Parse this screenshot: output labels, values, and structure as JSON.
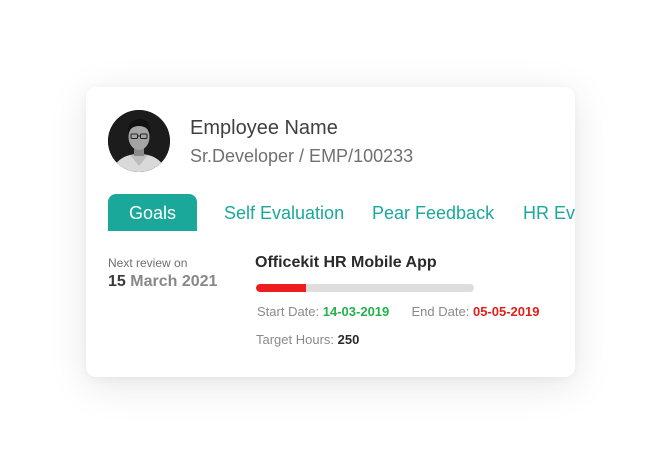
{
  "employee": {
    "name": "Employee Name",
    "subtitle": "Sr.Developer / EMP/100233"
  },
  "tabs": [
    {
      "label": "Goals",
      "active": true
    },
    {
      "label": "Self Evaluation",
      "active": false
    },
    {
      "label": "Pear Feedback",
      "active": false
    },
    {
      "label": "HR Evaluation",
      "active": false
    }
  ],
  "review": {
    "label": "Next review on",
    "day": "15",
    "month_year": "March 2021"
  },
  "project": {
    "title": "Officekit HR Mobile App",
    "progress_fraction": 0.23,
    "start_label": "Start Date:",
    "start_value": "14-03-2019",
    "end_label": "End Date:",
    "end_value": "05-05-2019",
    "target_label": "Target Hours:",
    "target_value": "250"
  },
  "colors": {
    "accent": "#1aa89a",
    "progress_fill": "#ee1c1c",
    "start_date": "#22b14c",
    "end_date": "#e0201a"
  }
}
